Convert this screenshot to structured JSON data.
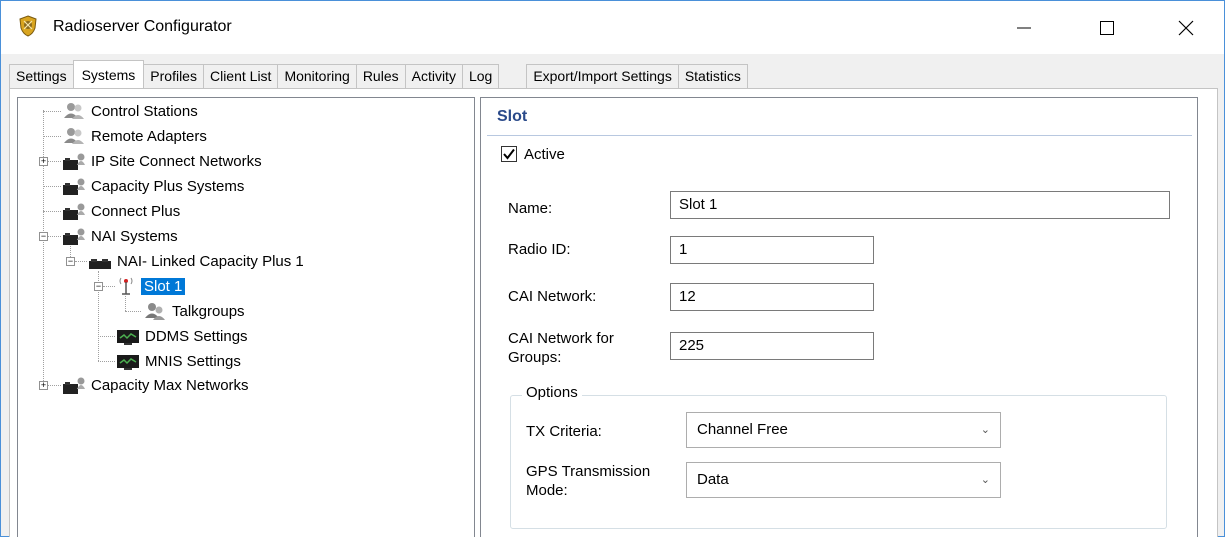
{
  "window": {
    "title": "Radioserver Configurator"
  },
  "tabs": [
    {
      "label": "Settings"
    },
    {
      "label": "Systems"
    },
    {
      "label": "Profiles"
    },
    {
      "label": "Client List"
    },
    {
      "label": "Monitoring"
    },
    {
      "label": "Rules"
    },
    {
      "label": "Activity"
    },
    {
      "label": "Log"
    },
    {
      "label": "Export/Import Settings"
    },
    {
      "label": "Statistics"
    }
  ],
  "active_tab": "Systems",
  "tree": {
    "items": [
      {
        "label": "Control Stations",
        "icon": "people-icon"
      },
      {
        "label": "Remote Adapters",
        "icon": "people-icon"
      },
      {
        "label": "IP Site Connect Networks",
        "icon": "network-icon"
      },
      {
        "label": "Capacity Plus Systems",
        "icon": "network-icon"
      },
      {
        "label": "Connect Plus",
        "icon": "network-icon"
      },
      {
        "label": "NAI Systems",
        "icon": "network-icon"
      },
      {
        "label": "NAI- Linked Capacity Plus 1",
        "icon": "network-icon"
      },
      {
        "label": "Slot 1",
        "icon": "antenna-icon"
      },
      {
        "label": "Talkgroups",
        "icon": "people-icon"
      },
      {
        "label": "DDMS Settings",
        "icon": "monitor-icon"
      },
      {
        "label": "MNIS Settings",
        "icon": "monitor-icon"
      },
      {
        "label": "Capacity Max Networks",
        "icon": "network-icon"
      }
    ]
  },
  "panel": {
    "title": "Slot",
    "active_label": "Active",
    "active_checked": true,
    "name_label": "Name:",
    "name_value": "Slot 1",
    "radio_id_label": "Radio ID:",
    "radio_id_value": "1",
    "cai_network_label": "CAI Network:",
    "cai_network_value": "12",
    "cai_groups_label_1": "CAI Network for",
    "cai_groups_label_2": "Groups:",
    "cai_groups_value": "225",
    "options_label": "Options",
    "tx_criteria_label": "TX Criteria:",
    "tx_criteria_value": "Channel Free",
    "gps_label_1": "GPS Transmission",
    "gps_label_2": "Mode:",
    "gps_value": "Data"
  },
  "colors": {
    "selection": "#0078d7",
    "section_title": "#2a4a8a",
    "window_border": "#4a90d9"
  }
}
